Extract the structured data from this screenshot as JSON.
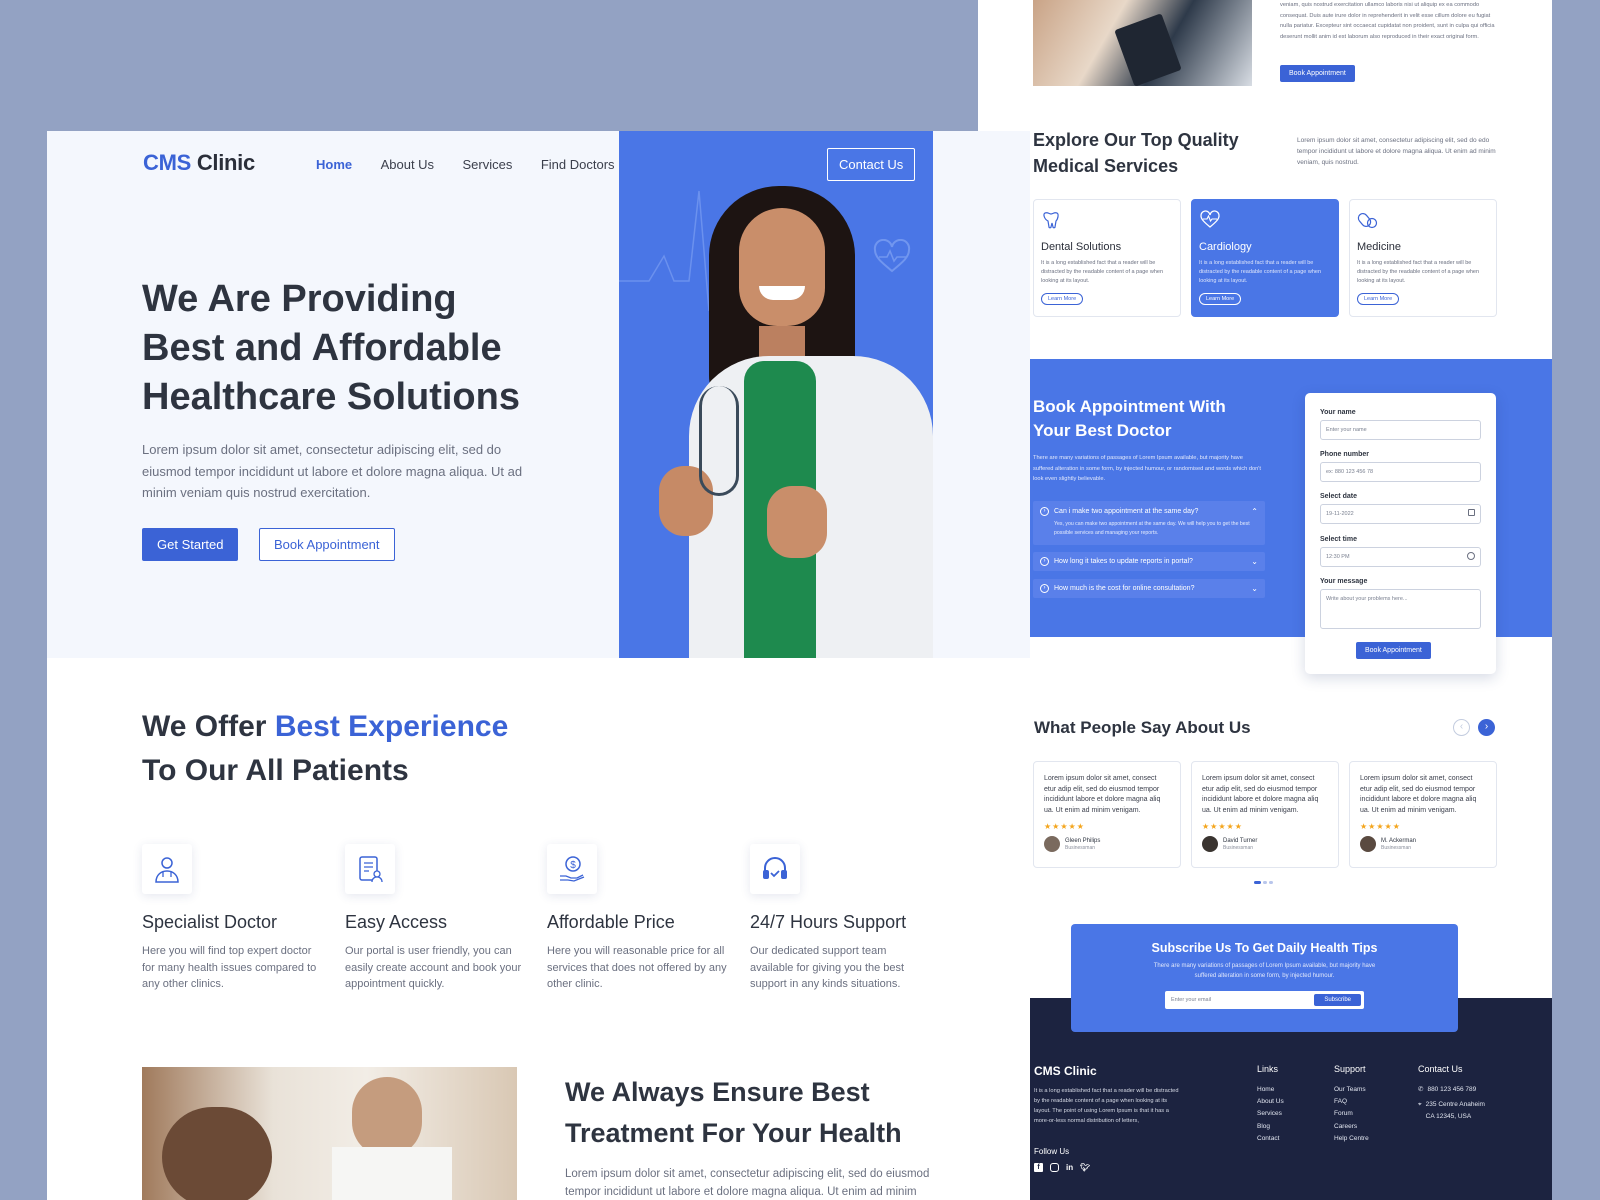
{
  "brand": {
    "name_part1": "CMS",
    "name_part2": "Clinic"
  },
  "nav": {
    "items": [
      "Home",
      "About Us",
      "Services",
      "Find Doctors"
    ],
    "contact": "Contact Us"
  },
  "hero": {
    "title_line1": "We Are Providing",
    "title_line2": "Best and Affordable",
    "title_line3": "Healthcare Solutions",
    "desc": "Lorem ipsum dolor sit amet, consectetur adipiscing elit, sed do eiusmod tempor incididunt ut labore et dolore magna aliqua. Ut ad minim veniam quis nostrud exercitation.",
    "btn_primary": "Get Started",
    "btn_secondary": "Book Appointment"
  },
  "offer": {
    "title_a": "We Offer",
    "title_b": "Best Experience",
    "title_c": "To Our All Patients",
    "features": [
      {
        "title": "Specialist Doctor",
        "desc": "Here you will find top expert doctor for many health issues compared to any other clinics.",
        "icon": "doctor-icon"
      },
      {
        "title": "Easy Access",
        "desc": "Our portal is user friendly, you can easily create account and book your appointment quickly.",
        "icon": "document-user-icon"
      },
      {
        "title": "Affordable Price",
        "desc": "Here you will reasonable price for all services that does not offered by any other clinic.",
        "icon": "dollar-hand-icon"
      },
      {
        "title": "24/7 Hours Support",
        "desc": "Our dedicated support team available for giving you the  best support in any kinds situations.",
        "icon": "headset-icon"
      }
    ]
  },
  "treatment": {
    "title_line1": "We Always Ensure Best",
    "title_line2": "Treatment For Your Health",
    "desc": "Lorem ipsum dolor sit amet, consectetur adipiscing elit, sed do eiusmod tempor incididunt ut labore et dolore magna aliqua. Ut enim ad minim"
  },
  "about_top": {
    "desc": "veniam, quis nostrud exercitation ullamco laboris nisi ut aliquip ex ea commodo consequat. Duis aute irure dolor in reprehenderit in velit esse cillum dolore eu fugiat nulla pariatur. Excepteur sint occaecat cupidatat non proident, sunt in culpa qui officia deserunt mollit anim id est laborum also reproduced in their exact original form.",
    "btn": "Book Appointment"
  },
  "services": {
    "title_line1": "Explore Our Top Quality",
    "title_line2": "Medical Services",
    "desc": "Lorem ipsum dolor sit amet, consectetur adipiscing elit, sed do edo tempor incididunt ut labore et dolore magna aliqua. Ut enim ad minim veniam, quis nostrud.",
    "cards": [
      {
        "title": "Dental Solutions",
        "desc": "It is a long established fact that a reader will be distracted by the readable content of a page when looking at its layout.",
        "btn": "Learn More",
        "icon": "tooth-icon"
      },
      {
        "title": "Cardiology",
        "desc": "It is a long established fact that a reader will be distracted by the readable content of a page when looking at its layout.",
        "btn": "Learn More",
        "icon": "heart-pulse-icon"
      },
      {
        "title": "Medicine",
        "desc": "It is a long established fact that a reader will be distracted by the readable content of a page when looking at its layout.",
        "btn": "Learn More",
        "icon": "pills-icon"
      }
    ]
  },
  "booking": {
    "title_line1": "Book Appointment With",
    "title_line2": "Your Best Doctor",
    "desc": "There are many variations of passages of Lorem Ipsum available, but majority have suffered alteration in some form, by injected humour, or randomised and words which don't look even slightly believable.",
    "faq": [
      {
        "q": "Can i make two appointment at the same day?",
        "a": "Yes, you can make two appointment at the same day. We will help you to get the best possible services and managing your reports."
      },
      {
        "q": "How long it takes to update reports in portal?"
      },
      {
        "q": "How much is the cost for online consultation?"
      }
    ],
    "form": {
      "name_label": "Your name",
      "name_ph": "Enter your name",
      "phone_label": "Phone number",
      "phone_ph": "ex: 880 123 456 78",
      "date_label": "Select date",
      "date_val": "19-11-2022",
      "time_label": "Select time",
      "time_val": "12:30 PM",
      "msg_label": "Your message",
      "msg_ph": "Write about your problems here...",
      "submit": "Book Appointment"
    }
  },
  "testimonials": {
    "title": "What People Say About Us",
    "items": [
      {
        "text": "Lorem ipsum dolor sit amet, consect etur adip elit, sed do eiusmod tempor incididunt labore et dolore magna aliq ua. Ut enim ad minim venigam.",
        "stars": "★★★★★",
        "name": "Gleen Philips",
        "role": "Businessman"
      },
      {
        "text": "Lorem ipsum dolor sit amet, consect etur adip elit, sed do eiusmod tempor incididunt labore et dolore magna aliq ua. Ut enim ad minim venigam.",
        "stars": "★★★★★",
        "name": "David Turner",
        "role": "Businessman"
      },
      {
        "text": "Lorem ipsum dolor sit amet, consect etur adip elit, sed do eiusmod tempor incididunt labore et dolore magna aliq ua. Ut enim ad minim venigam.",
        "stars": "★★★★★",
        "name": "M. Ackerman",
        "role": "Businessman"
      }
    ]
  },
  "subscribe": {
    "title": "Subscribe Us To Get Daily Health Tips",
    "desc": "There are many variations of passages of Lorem Ipsum available, but majority have suffered alteration in some form, by injected humour.",
    "placeholder": "Enter your email",
    "btn": "Subscribe"
  },
  "footer": {
    "brand": "CMS Clinic",
    "desc": "It is a long established fact that a reader will be distracted by the readable content of a page when looking at its layout. The point of using Lorem Ipsum is that it has a more-or-less normal distribution of letters,",
    "follow": "Follow Us",
    "links_title": "Links",
    "links": [
      "Home",
      "About Us",
      "Services",
      "Blog",
      "Contact"
    ],
    "support_title": "Support",
    "support": [
      "Our Teams",
      "FAQ",
      "Forum",
      "Careers",
      "Help Centre"
    ],
    "contact_title": "Contact Us",
    "phone": "880 123 456 789",
    "address_line1": "235 Centre Anaheim",
    "address_line2": "CA 12345, USA"
  },
  "colors": {
    "primary": "#3b63d6",
    "hero_blue": "#4a76e6",
    "footer": "#1c2340",
    "page_bg": "#93a2c3"
  }
}
